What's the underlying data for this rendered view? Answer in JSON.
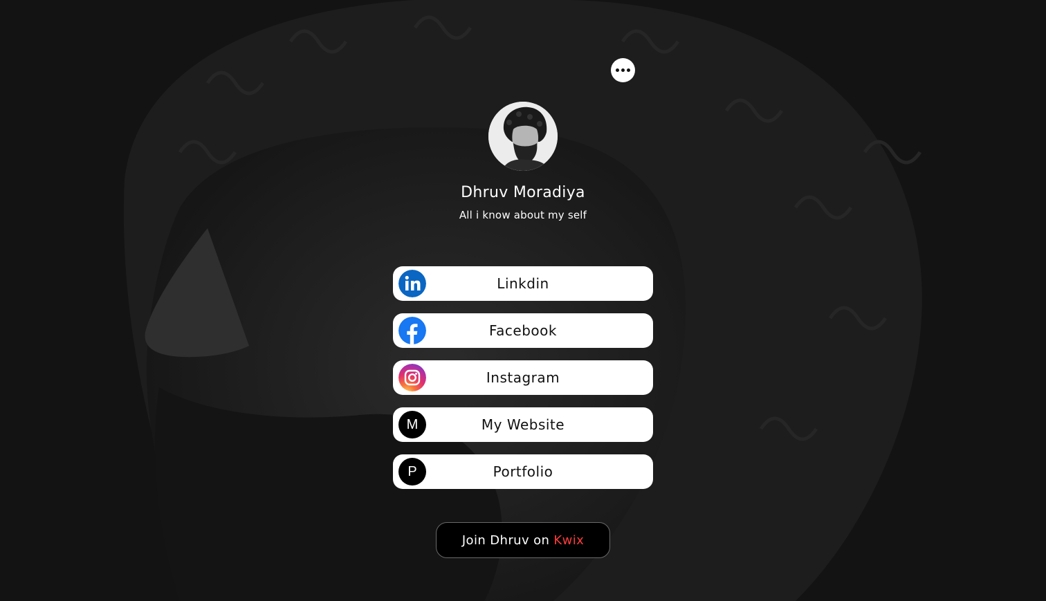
{
  "profile": {
    "name": "Dhruv Moradiya",
    "bio": "All i know about my self"
  },
  "links": [
    {
      "label": "Linkdin",
      "icon": "linkedin-icon"
    },
    {
      "label": "Facebook",
      "icon": "facebook-icon"
    },
    {
      "label": "Instagram",
      "icon": "instagram-icon"
    },
    {
      "label": "My Website",
      "icon": "letter-m-icon",
      "letter": "M"
    },
    {
      "label": "Portfolio",
      "icon": "letter-p-icon",
      "letter": "P"
    }
  ],
  "join": {
    "prefix": "Join Dhruv on",
    "brand": "Kwix",
    "brand_color": "#ff3b3b"
  },
  "colors": {
    "background": "#141414",
    "button": "#ffffff",
    "linkedin": "#0a66c2",
    "facebook": "#1877f2"
  }
}
